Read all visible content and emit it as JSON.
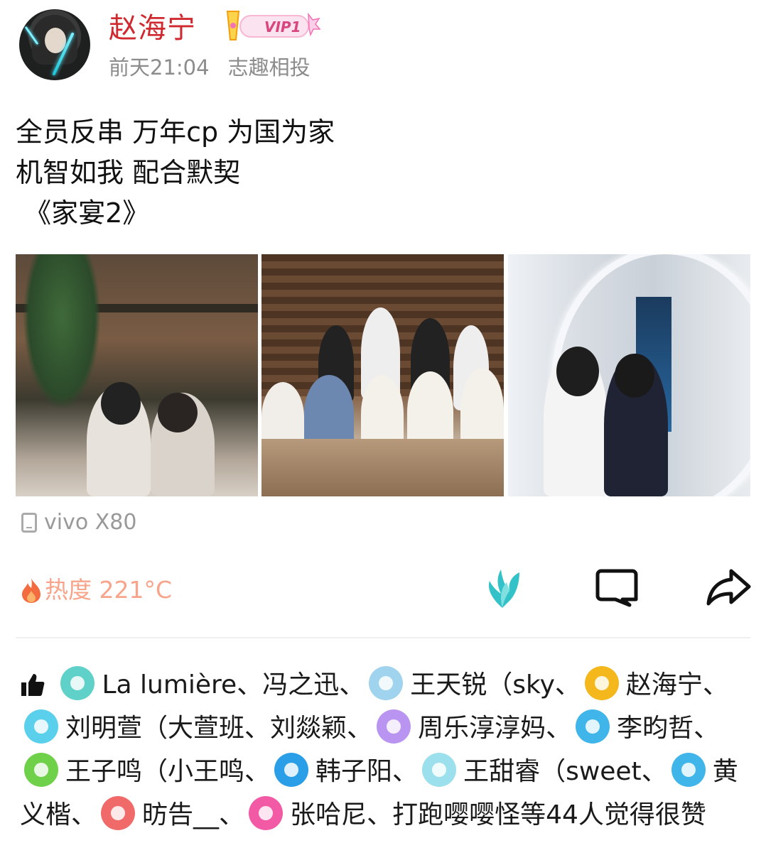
{
  "header": {
    "username": "赵海宁",
    "vip_label": "VIP1",
    "time": "前天21:04",
    "source": "志趣相投"
  },
  "post": {
    "lines": [
      "全员反串 万年cp 为国为家",
      "机智如我 配合默契",
      " 《家宴2》"
    ]
  },
  "device": {
    "label": "vivo X80",
    "icon": "phone-icon"
  },
  "actions": {
    "heat_label": "热度 221°C",
    "like_icon": "wing-icon",
    "comment_icon": "comment-icon",
    "share_icon": "share-icon"
  },
  "likes": {
    "users": [
      {
        "name": "La lumière",
        "sep": "、",
        "color": "#5fd1c9"
      },
      {
        "name": "冯之迅",
        "sep": "、",
        "color": null
      },
      {
        "name": "王天锐（sky",
        "sep": "、",
        "color": "#9fd3ee"
      },
      {
        "name": "赵海宁",
        "sep": "、",
        "color": "#f5b81c"
      },
      {
        "name": "刘明萱（大萱班",
        "sep": "、",
        "color": "#5bd0ec"
      },
      {
        "name": "刘燚颖",
        "sep": "、",
        "color": null
      },
      {
        "name": "周乐淳淳妈",
        "sep": "、",
        "color": "#b994f0"
      },
      {
        "name": "李昀哲",
        "sep": "、",
        "color": "#3fb5e9"
      },
      {
        "name": "王子鸣（小王鸣",
        "sep": "、",
        "color": "#6fd14a"
      },
      {
        "name": "韩子阳",
        "sep": "、",
        "color": "#2a9ee6"
      },
      {
        "name": "王甜睿（sweet",
        "sep": "、",
        "color": "#9be0ec"
      },
      {
        "name": "黄义楷",
        "sep": "、",
        "color": "#3fb5e9"
      },
      {
        "name": "昉告__",
        "sep": "、",
        "color": "#f06a6a"
      },
      {
        "name": "张哈尼",
        "sep": "、",
        "color": "#f25aa5"
      },
      {
        "name": "打跑嘤嘤怪",
        "sep": "",
        "color": null
      }
    ],
    "suffix": "等44人觉得很赞"
  },
  "colors": {
    "username": "#d0282f",
    "heat": "#f7a48a",
    "accent": "#33c2c7"
  }
}
